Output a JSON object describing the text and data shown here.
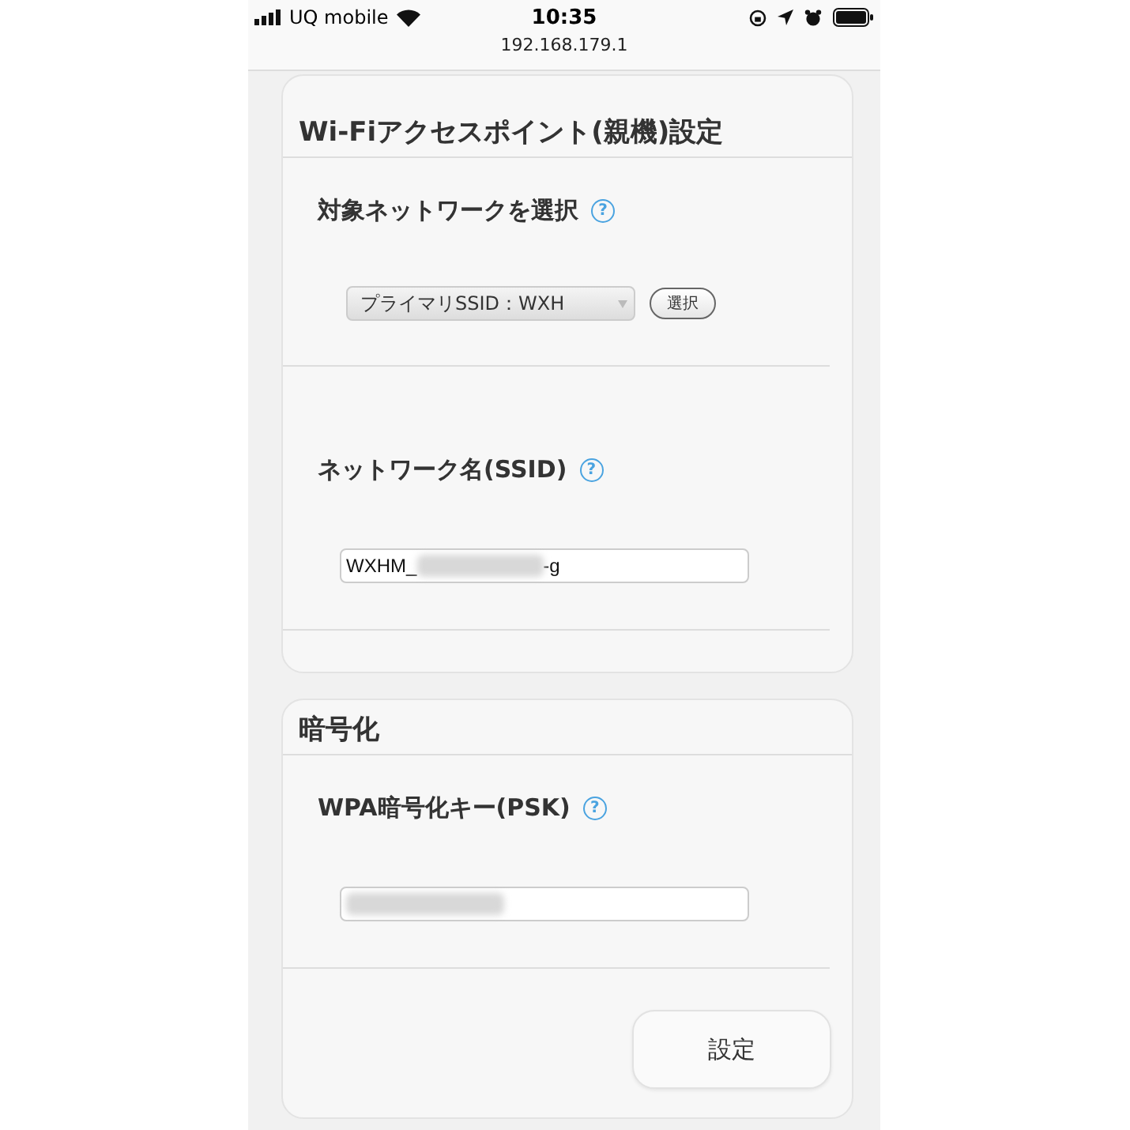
{
  "status_bar": {
    "carrier": "UQ mobile",
    "time": "10:35",
    "url": "192.168.179.1"
  },
  "sections": [
    {
      "title": "Wi-Fiアクセスポイント(親機)設定",
      "fields": [
        {
          "kind": "select",
          "label": "対象ネットワークを選択",
          "help": "?",
          "value": "プライマリSSID：WXH",
          "button": "選択"
        },
        {
          "kind": "text",
          "label": "ネットワーク名(SSID)",
          "help": "?",
          "prefix": "WXHM_",
          "suffix": "-g",
          "redacted": true
        }
      ]
    },
    {
      "title": "暗号化",
      "fields": [
        {
          "kind": "text",
          "label": "WPA暗号化キー(PSK)",
          "help": "?",
          "redacted": true
        }
      ],
      "submit": "設定"
    }
  ]
}
